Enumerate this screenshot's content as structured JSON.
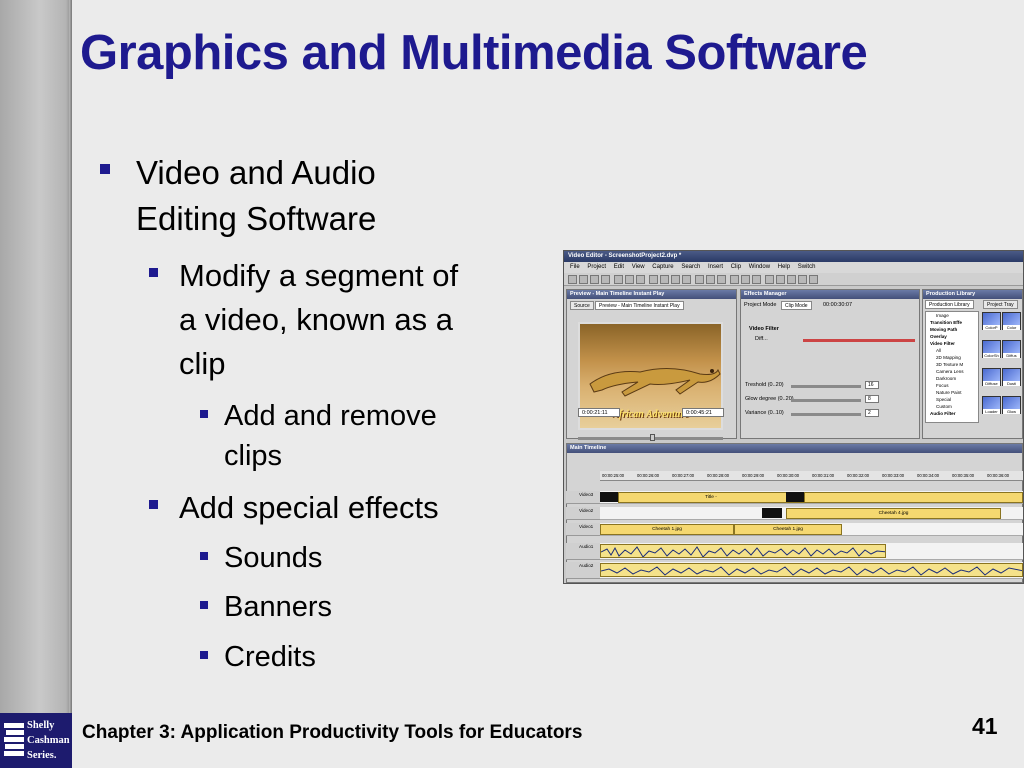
{
  "slide": {
    "title": "Graphics and Multimedia Software",
    "bullets": {
      "b1": "Video and Audio",
      "b1_cont": "Editing Software",
      "b2": "Modify a segment of",
      "b2_cont1": "a video, known as a",
      "b2_cont2": "clip",
      "b3": "Add and remove",
      "b3_cont": "clips",
      "b4": "Add special effects",
      "b5": "Sounds",
      "b6": "Banners",
      "b7": "Credits"
    },
    "footer": "Chapter 3: Application Productivity Tools for Educators",
    "page_number": "41",
    "series": {
      "line1": "Shelly",
      "line2": "Cashman",
      "line3": "Series."
    }
  },
  "screenshot": {
    "window_title": "Video Editor - ScreenshotProject2.dvp *",
    "menu": [
      "File",
      "Project",
      "Edit",
      "View",
      "Capture",
      "Search",
      "Insert",
      "Clip",
      "Window",
      "Help",
      "Switch"
    ],
    "preview": {
      "header": "Preview - Main Timeline Instant Play",
      "tab_source": "Source",
      "tab_preview": "Preview - Main Timeline Instant Play",
      "caption": "African Adventure",
      "tc_left": "0:00:21:11",
      "tc_right": "0:00:45:21"
    },
    "effects": {
      "header": "Effects Manager",
      "project_mode": "Project Mode",
      "clip_mode": "Clip Mode",
      "timecode": "00:00:30:07",
      "filter_label": "Video Filter",
      "diff": "Diff...",
      "threshold_label": "Treshold (0..20)",
      "threshold_val": "16",
      "glow_label": "Glow degree (0..20)",
      "glow_val": "8",
      "variance_label": "Variance (0..10)",
      "variance_val": "2"
    },
    "library": {
      "header": "Production Library",
      "tab_library": "Production Library",
      "tab_tray": "Project Tray",
      "items": [
        "Image",
        "Transition Effe",
        "Moving Path",
        "Overlay",
        "Video Filter",
        "All",
        "2D Mapping",
        "3D Texture M",
        "Camera Lens",
        "Darkroom",
        "Focus",
        "Nature Paint",
        "Special",
        "Custom",
        "Audio Filter"
      ],
      "thumbs": [
        "ColorP",
        "Color",
        "ColorSh",
        "Diffus",
        "Diffuse",
        "Dusti",
        "Loader",
        "Glow"
      ]
    },
    "timeline": {
      "header": "Main Timeline",
      "ticks": [
        "00:00:25:00",
        "00:00:26:00",
        "00:00:27:00",
        "00:00:28:00",
        "00:00:29:00",
        "00:00:30:00",
        "00:00:31:00",
        "00:00:32:00",
        "00:00:33:00",
        "00:00:34:00",
        "00:00:35:00",
        "00:00:36:00"
      ],
      "tracks": [
        "Video3",
        "Video2",
        "Video1",
        "Audio1",
        "Audio2"
      ],
      "clip_title": "Title -",
      "clip_cheetah4": "Cheetah 4.jpg",
      "clip_cheetah1": "Cheetah 1.jpg",
      "clip_cheetah1b": "Cheetah 1.jpg"
    }
  }
}
